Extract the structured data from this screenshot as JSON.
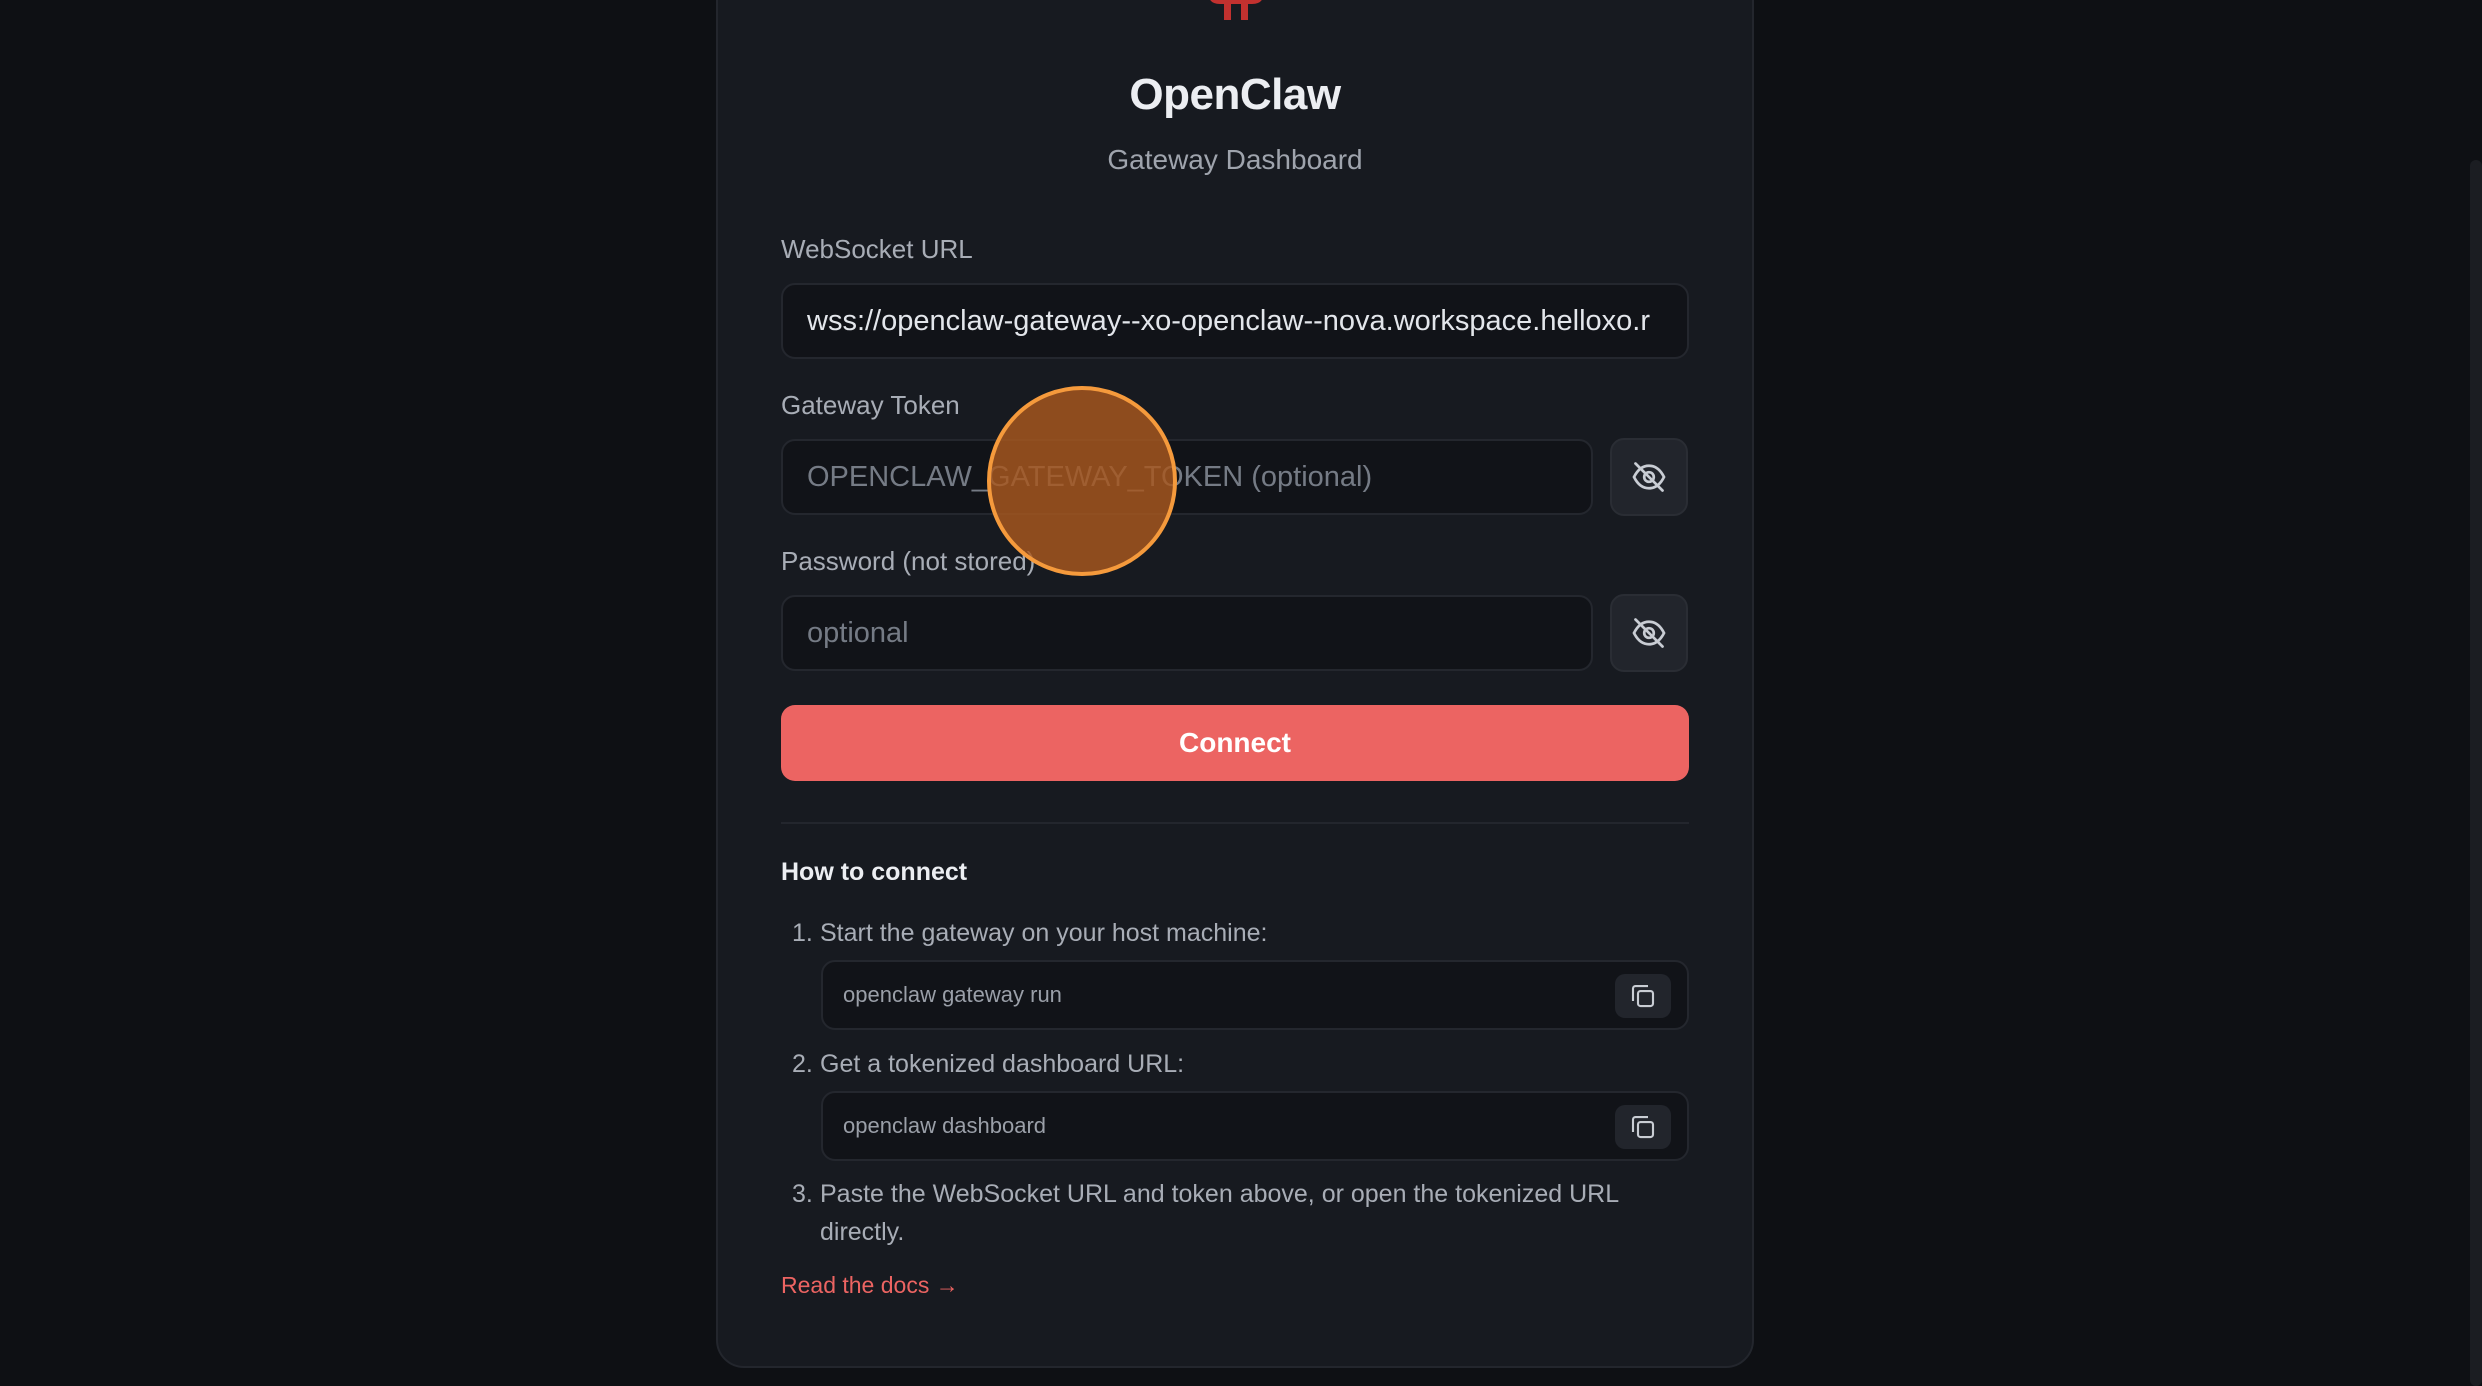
{
  "app": {
    "title": "OpenClaw",
    "subtitle": "Gateway Dashboard"
  },
  "form": {
    "ws_label": "WebSocket URL",
    "ws_value": "wss://openclaw-gateway--xo-openclaw--nova.workspace.helloxo.r",
    "token_label": "Gateway Token",
    "token_placeholder": "OPENCLAW_GATEWAY_TOKEN (optional)",
    "password_label": "Password (not stored)",
    "password_placeholder": "optional",
    "connect_label": "Connect"
  },
  "howto": {
    "title": "How to connect",
    "steps": [
      {
        "num": "1.",
        "text": "Start the gateway on your host machine:",
        "code": "openclaw gateway run"
      },
      {
        "num": "2.",
        "text": "Get a tokenized dashboard URL:",
        "code": "openclaw dashboard"
      },
      {
        "num": "3.",
        "text": "Paste the WebSocket URL and token above, or open the tokenized URL directly."
      }
    ],
    "docs_link": "Read the docs →"
  },
  "icons": {
    "logo": "openclaw-logo",
    "token_toggle": "eye-off-icon",
    "password_toggle": "eye-off-icon",
    "copy": "copy-icon"
  },
  "colors": {
    "accent": "#ec6462",
    "background": "#0e1014",
    "card": "#171a20",
    "cursor": "#f59a3c"
  }
}
